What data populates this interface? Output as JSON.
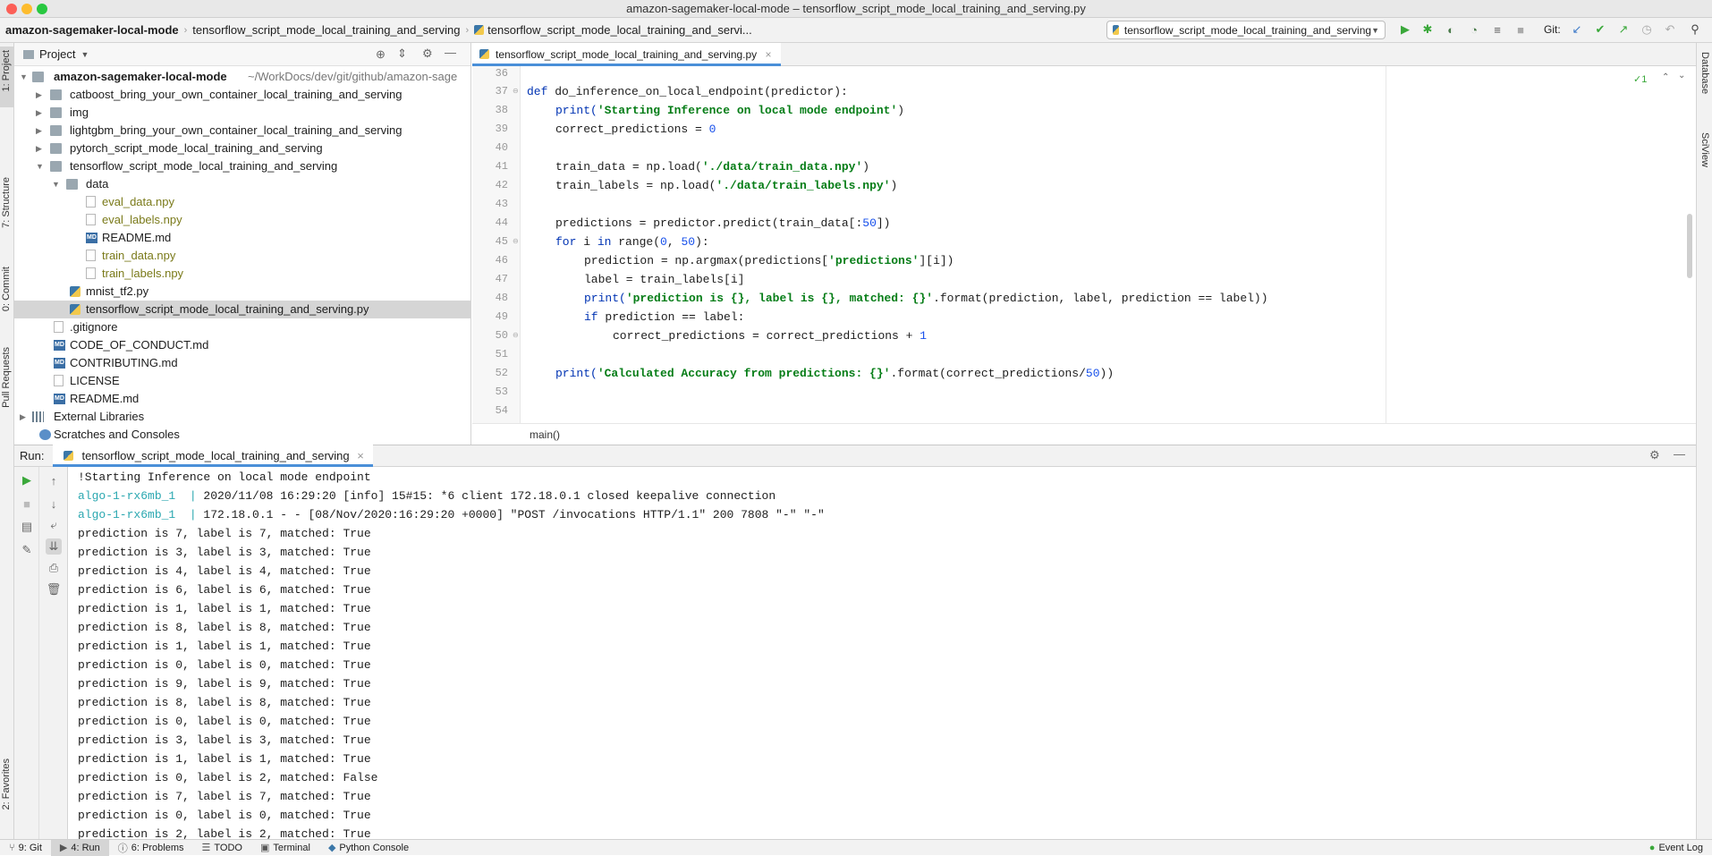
{
  "window": {
    "title": "amazon-sagemaker-local-mode – tensorflow_script_mode_local_training_and_serving.py"
  },
  "nav": {
    "crumbs": [
      "amazon-sagemaker-local-mode",
      "tensorflow_script_mode_local_training_and_serving",
      "tensorflow_script_mode_local_training_and_servi..."
    ],
    "run_config": "tensorflow_script_mode_local_training_and_serving",
    "git_label": "Git:"
  },
  "left_tabs": [
    "1: Project",
    "7: Structure",
    "0: Commit",
    "Pull Requests",
    "2: Favorites"
  ],
  "right_tabs": [
    "Database",
    "SciView"
  ],
  "project": {
    "header": "Project",
    "root": {
      "name": "amazon-sagemaker-local-mode",
      "path": "~/WorkDocs/dev/git/github/amazon-sage"
    },
    "items": [
      "catboost_bring_your_own_container_local_training_and_serving",
      "img",
      "lightgbm_bring_your_own_container_local_training_and_serving",
      "pytorch_script_mode_local_training_and_serving",
      "tensorflow_script_mode_local_training_and_serving",
      "data",
      "eval_data.npy",
      "eval_labels.npy",
      "README.md",
      "train_data.npy",
      "train_labels.npy",
      "mnist_tf2.py",
      "tensorflow_script_mode_local_training_and_serving.py",
      ".gitignore",
      "CODE_OF_CONDUCT.md",
      "CONTRIBUTING.md",
      "LICENSE",
      "README.md",
      "External Libraries",
      "Scratches and Consoles"
    ]
  },
  "editor": {
    "tab": "tensorflow_script_mode_local_training_and_serving.py",
    "inspection": "✓1",
    "line_numbers": [
      "36",
      "37",
      "38",
      "39",
      "40",
      "41",
      "42",
      "43",
      "44",
      "45",
      "46",
      "47",
      "48",
      "49",
      "50",
      "51",
      "52",
      "53",
      "54"
    ],
    "breadcrumb": "main()",
    "lines": {
      "l37": {
        "kw": "def",
        "rest": " do_inference_on_local_endpoint(predictor):"
      },
      "l38": {
        "fn": "print(",
        "str": "'Starting Inference on local mode endpoint'",
        "end": ")"
      },
      "l39": {
        "a": "correct_predictions = ",
        "num": "0"
      },
      "l41": {
        "a": "train_data = np.load(",
        "str": "'./data/train_data.npy'",
        "end": ")"
      },
      "l42": {
        "a": "train_labels = np.load(",
        "str": "'./data/train_labels.npy'",
        "end": ")"
      },
      "l44": {
        "a": "predictions = predictor.predict(train_data[:",
        "num": "50",
        "end": "])"
      },
      "l45": {
        "kw1": "for",
        "a": " i ",
        "kw2": "in",
        "b": " range(",
        "n1": "0",
        "c": ", ",
        "n2": "50",
        "end": "):"
      },
      "l46": {
        "a": "prediction = np.argmax(predictions[",
        "str": "'predictions'",
        "end": "][i])"
      },
      "l47": {
        "a": "label = train_labels[i]"
      },
      "l48": {
        "fn": "print(",
        "str": "'prediction is {}, label is {}, matched: {}'",
        "end": ".format(prediction, label, prediction == label))"
      },
      "l49": {
        "kw": "if",
        "rest": " prediction == label:"
      },
      "l50": {
        "a": "correct_predictions = correct_predictions + ",
        "num": "1"
      },
      "l52": {
        "fn": "print(",
        "str": "'Calculated Accuracy from predictions: {}'",
        "end": ".format(correct_predictions/",
        "num": "50",
        "end2": "))"
      }
    }
  },
  "run": {
    "label": "Run:",
    "tab": "tensorflow_script_mode_local_training_and_serving",
    "lines": [
      {
        "text": "!Starting Inference on local mode endpoint"
      },
      {
        "prefix": "algo-1-rx6mb_1  |",
        "text": " 2020/11/08 16:29:20 [info] 15#15: *6 client 172.18.0.1 closed keepalive connection"
      },
      {
        "prefix": "algo-1-rx6mb_1  |",
        "text": " 172.18.0.1 - - [08/Nov/2020:16:29:20 +0000] \"POST /invocations HTTP/1.1\" 200 7808 \"-\" \"-\""
      },
      {
        "text": "prediction is 7, label is 7, matched: True"
      },
      {
        "text": "prediction is 3, label is 3, matched: True"
      },
      {
        "text": "prediction is 4, label is 4, matched: True"
      },
      {
        "text": "prediction is 6, label is 6, matched: True"
      },
      {
        "text": "prediction is 1, label is 1, matched: True"
      },
      {
        "text": "prediction is 8, label is 8, matched: True"
      },
      {
        "text": "prediction is 1, label is 1, matched: True"
      },
      {
        "text": "prediction is 0, label is 0, matched: True"
      },
      {
        "text": "prediction is 9, label is 9, matched: True"
      },
      {
        "text": "prediction is 8, label is 8, matched: True"
      },
      {
        "text": "prediction is 0, label is 0, matched: True"
      },
      {
        "text": "prediction is 3, label is 3, matched: True"
      },
      {
        "text": "prediction is 1, label is 1, matched: True"
      },
      {
        "text": "prediction is 0, label is 2, matched: False"
      },
      {
        "text": "prediction is 7, label is 7, matched: True"
      },
      {
        "text": "prediction is 0, label is 0, matched: True"
      },
      {
        "text": "prediction is 2, label is 2, matched: True"
      }
    ]
  },
  "status": {
    "items": [
      "9: Git",
      "4: Run",
      "6: Problems",
      "TODO",
      "Terminal",
      "Python Console"
    ],
    "event_log": "Event Log"
  }
}
